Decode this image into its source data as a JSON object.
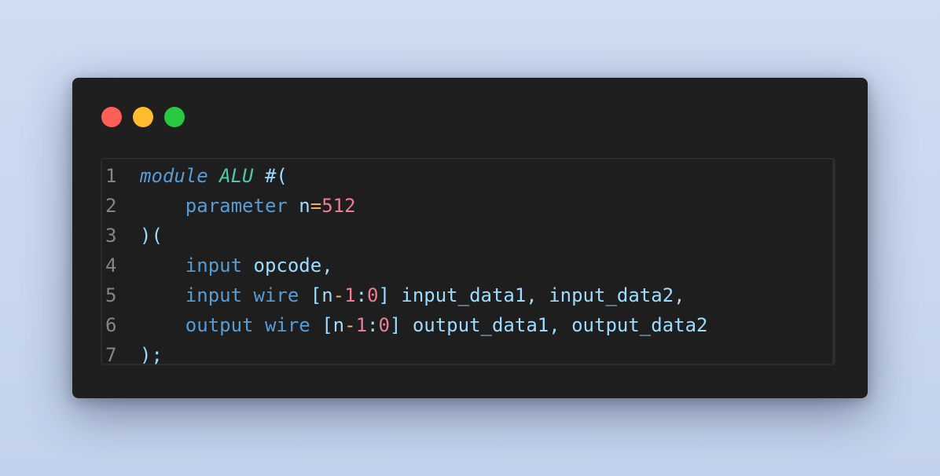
{
  "colors": {
    "close": "#ff5f57",
    "minimize": "#febc2e",
    "maximize": "#28c840",
    "window_bg": "#1f1f1f",
    "line_number": "#858585"
  },
  "window_controls": [
    {
      "name": "close-button",
      "color": "#ff5f57"
    },
    {
      "name": "minimize-button",
      "color": "#febc2e"
    },
    {
      "name": "maximize-button",
      "color": "#28c840"
    }
  ],
  "code": {
    "lines": [
      {
        "number": "1",
        "tokens": [
          {
            "t": "module",
            "c": "#569cd6",
            "i": true
          },
          {
            "t": " ",
            "c": "#d4d4d4"
          },
          {
            "t": "ALU",
            "c": "#4ec9b0",
            "i": true
          },
          {
            "t": " #(",
            "c": "#9cdcfe"
          }
        ]
      },
      {
        "number": "2",
        "tokens": [
          {
            "t": "    ",
            "c": "#d4d4d4"
          },
          {
            "t": "parameter",
            "c": "#569cd6"
          },
          {
            "t": " ",
            "c": "#d4d4d4"
          },
          {
            "t": "n",
            "c": "#9cdcfe"
          },
          {
            "t": "=",
            "c": "#f2b15f"
          },
          {
            "t": "512",
            "c": "#f07c93"
          }
        ]
      },
      {
        "number": "3",
        "tokens": [
          {
            "t": ")(",
            "c": "#9cdcfe"
          }
        ]
      },
      {
        "number": "4",
        "tokens": [
          {
            "t": "    ",
            "c": "#d4d4d4"
          },
          {
            "t": "input",
            "c": "#569cd6"
          },
          {
            "t": " ",
            "c": "#d4d4d4"
          },
          {
            "t": "opcode,",
            "c": "#9cdcfe"
          }
        ]
      },
      {
        "number": "5",
        "tokens": [
          {
            "t": "    ",
            "c": "#d4d4d4"
          },
          {
            "t": "input",
            "c": "#569cd6"
          },
          {
            "t": " ",
            "c": "#d4d4d4"
          },
          {
            "t": "wire",
            "c": "#569cd6"
          },
          {
            "t": " [n",
            "c": "#9cdcfe"
          },
          {
            "t": "-",
            "c": "#f2b15f"
          },
          {
            "t": "1",
            "c": "#f07c93"
          },
          {
            "t": ":",
            "c": "#9cdcfe"
          },
          {
            "t": "0",
            "c": "#f07c93"
          },
          {
            "t": "] input_data1, input_data2,",
            "c": "#9cdcfe"
          }
        ]
      },
      {
        "number": "6",
        "tokens": [
          {
            "t": "    ",
            "c": "#d4d4d4"
          },
          {
            "t": "output",
            "c": "#569cd6"
          },
          {
            "t": " ",
            "c": "#d4d4d4"
          },
          {
            "t": "wire",
            "c": "#569cd6"
          },
          {
            "t": " [n",
            "c": "#9cdcfe"
          },
          {
            "t": "-",
            "c": "#f2b15f"
          },
          {
            "t": "1",
            "c": "#f07c93"
          },
          {
            "t": ":",
            "c": "#9cdcfe"
          },
          {
            "t": "0",
            "c": "#f07c93"
          },
          {
            "t": "] output_data1, output_data2",
            "c": "#9cdcfe"
          }
        ]
      },
      {
        "number": "7",
        "tokens": [
          {
            "t": ");",
            "c": "#9cdcfe"
          }
        ]
      }
    ]
  }
}
